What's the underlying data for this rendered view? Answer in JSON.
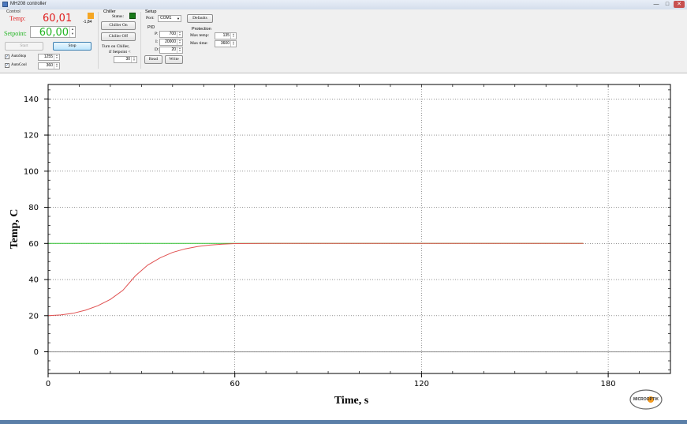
{
  "window": {
    "title": "MH208 controller",
    "minimize": "—",
    "maximize": "□",
    "close": "✕"
  },
  "control": {
    "group_label": "Control",
    "temp_label": "Temp:",
    "temp_value": "60,01",
    "delta_value": "-1,84",
    "setpoint_label": "Setpoint:",
    "setpoint_value": "60,00",
    "start_label": "Start",
    "stop_label": "Stop",
    "autostop_label": "AutoStop",
    "autostop_checked": "✓",
    "autostop_value": "1255",
    "autocool_label": "AutoCool",
    "autocool_checked": "✓",
    "autocool_value": "360",
    "indicator_color": "#f5a623",
    "temp_color": "#e02020",
    "setpoint_color": "#22b422"
  },
  "chiller": {
    "group_label": "Chiller",
    "status_label": "Status:",
    "status_color": "#1a7a1a",
    "on_label": "Chiller On",
    "off_label": "Chiller Off",
    "turn_on_label": "Turn on Chiller,",
    "turn_on_label2": "if Setpoint <",
    "threshold_value": "30"
  },
  "setup": {
    "group_label": "Setup",
    "port_label": "Port:",
    "port_value": "COM1",
    "defaults_label": "Defaults",
    "pid_label": "PID",
    "p_label": "P:",
    "p_value": "700",
    "i_label": "I:",
    "i_value": "20000",
    "d_label": "D:",
    "d_value": "20",
    "read_label": "Read",
    "write_label": "Write",
    "protection_label": "Protection",
    "max_temp_label": "Max temp:",
    "max_temp_value": "135",
    "max_time_label": "Max time:",
    "max_time_value": "3600"
  },
  "logo": {
    "text": "MICROOPTIK"
  },
  "chart_data": {
    "type": "line",
    "xlabel": "Time, s",
    "ylabel": "Temp, C",
    "xlim": [
      0,
      200
    ],
    "ylim": [
      -12,
      148
    ],
    "xticks": [
      0,
      60,
      120,
      180
    ],
    "yticks": [
      0,
      20,
      40,
      60,
      80,
      100,
      120,
      140
    ],
    "grid": "dotted",
    "series": [
      {
        "color": "#e05050",
        "x": [
          0,
          4,
          8,
          12,
          16,
          20,
          24,
          28,
          32,
          36,
          40,
          44,
          48,
          52,
          56,
          60,
          70,
          80,
          100,
          120,
          140,
          160,
          172
        ],
        "y": [
          20,
          20.4,
          21.3,
          23,
          25.5,
          29,
          34,
          42,
          48,
          52,
          55,
          57,
          58.3,
          59.1,
          59.6,
          59.9,
          60,
          60,
          60,
          60,
          60,
          60,
          60.01
        ]
      },
      {
        "color": "#30c030",
        "x": [
          0,
          172
        ],
        "y": [
          60,
          60
        ]
      },
      {
        "color": "#909090",
        "x": [
          0,
          200
        ],
        "y": [
          0,
          0
        ]
      }
    ]
  }
}
